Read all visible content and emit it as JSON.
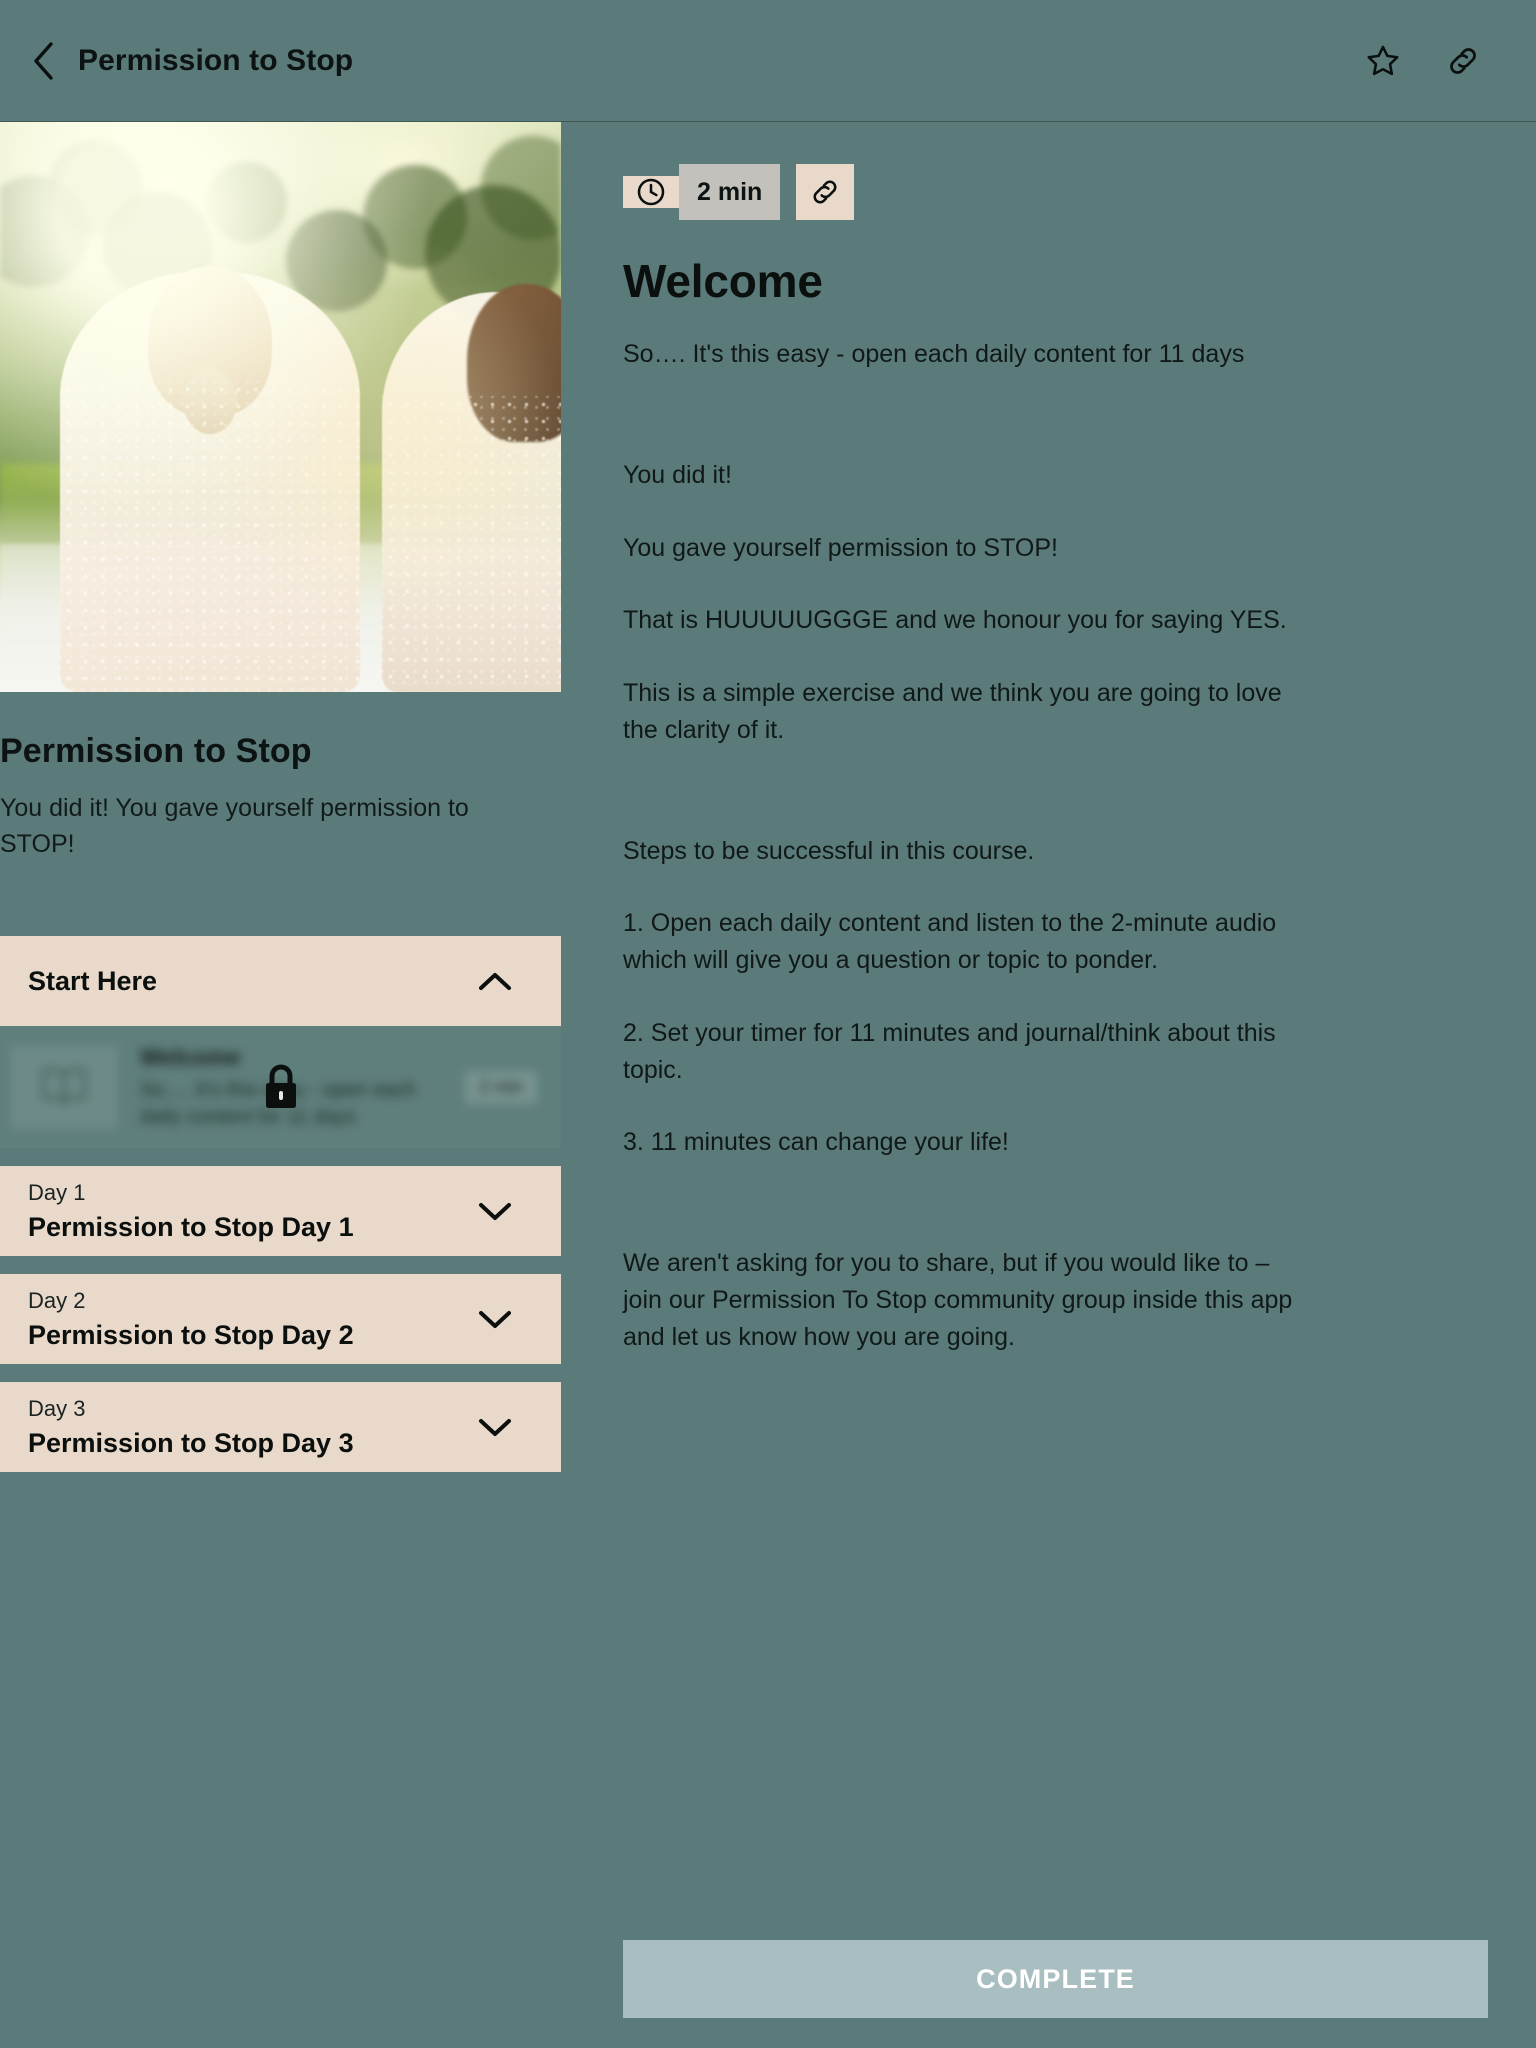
{
  "header": {
    "back_icon": "chevron-left-icon",
    "title": "Permission to Stop",
    "favorite_icon": "star-icon",
    "share_icon": "link-icon"
  },
  "course": {
    "title": "Permission to Stop",
    "subtitle": "You did it! You gave yourself permission to STOP!",
    "hero_alt": "Two women standing outdoors with backs to camera in sunlit garden"
  },
  "curriculum": {
    "sections": [
      {
        "label": "Start Here",
        "state": "expanded",
        "chevron": "chevron-up-icon",
        "items": [
          {
            "title": "Welcome",
            "description": "So…. It's this easy - open each daily content for 11 days",
            "duration": "2 min",
            "locked": true,
            "lock_icon": "lock-icon",
            "thumb_icon": "book-icon"
          }
        ]
      },
      {
        "eyebrow": "Day 1",
        "label": "Permission to Stop Day 1",
        "state": "collapsed",
        "chevron": "chevron-down-icon",
        "items": []
      },
      {
        "eyebrow": "Day 2",
        "label": "Permission to Stop Day 2",
        "state": "collapsed",
        "chevron": "chevron-down-icon",
        "items": []
      },
      {
        "eyebrow": "Day 3",
        "label": "Permission to Stop Day 3",
        "state": "collapsed",
        "chevron": "chevron-down-icon",
        "items": []
      }
    ]
  },
  "lesson": {
    "clock_icon": "clock-icon",
    "duration": "2 min",
    "link_icon": "link-icon",
    "title": "Welcome",
    "intro": "So…. It's this easy - open each daily content for 11 days",
    "paragraphs": [
      "You did it!",
      "You gave yourself permission to STOP!",
      "That is HUUUUUGGGE and we honour you for saying YES.",
      "This is a simple exercise and we think you are going to love the clarity of it.",
      "Steps to be successful in this course.",
      "1. Open each daily content and listen to the 2-minute audio which will give you a question or topic to ponder.",
      "2. Set your timer for 11 minutes and journal/think about this topic.",
      "3. 11 minutes can change your life!",
      "We aren't asking for you to share, but if you would like to – join our Permission To Stop community group inside this app and let us know how you are going."
    ],
    "complete_label": "COMPLETE"
  },
  "colors": {
    "page_bg": "#5a7b79",
    "accent_beige": "#e9d9cb",
    "chip_gray": "#c2c1bb",
    "complete_btn": "#a9bec1",
    "text_dark": "#0b100f"
  }
}
